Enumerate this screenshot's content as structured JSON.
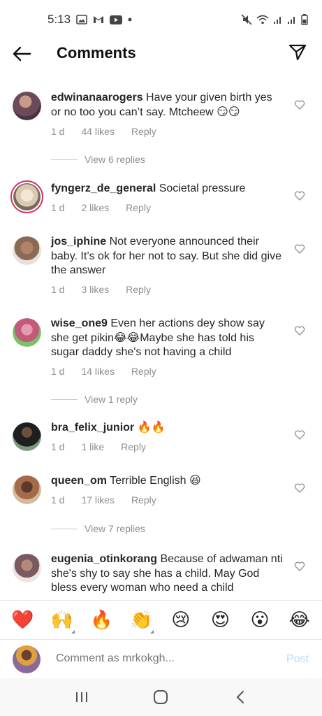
{
  "status_bar": {
    "time": "5:13",
    "icons_left": [
      "gallery-icon",
      "gmail-icon",
      "youtube-icon",
      "dot-icon"
    ],
    "icons_right": [
      "mute-icon",
      "wifi-icon",
      "signal-icon",
      "signal-icon",
      "battery-icon"
    ]
  },
  "header": {
    "title": "Comments",
    "back_icon": "arrow-left-icon",
    "send_icon": "paper-plane-icon"
  },
  "comments": [
    {
      "username": "edwinanaarogers",
      "text": " Have your given birth yes or no too you can’t say. Mtcheew 😏😏",
      "time": "1 d",
      "likes": "44 likes",
      "reply": "Reply",
      "avatar_color": "#6b4a5a",
      "story_ring": false
    },
    {
      "username": "fyngerz_de_general",
      "text": " Societal pressure",
      "time": "1 d",
      "likes": "2 likes",
      "reply": "Reply",
      "avatar_color": "#d9c9b3",
      "story_ring": true
    },
    {
      "username": "jos_iphine",
      "text": " Not everyone announced their baby. It’s ok for her not to say. But she did give the answer",
      "time": "1 d",
      "likes": "3 likes",
      "reply": "Reply",
      "avatar_color": "#8a6a55",
      "story_ring": false
    },
    {
      "username": "wise_one9",
      "text": " Even her actions dey show say she get pikin😂😂Maybe she has told his sugar daddy she's not having a child",
      "time": "1 d",
      "likes": "14 likes",
      "reply": "Reply",
      "avatar_color": "#c25a7a",
      "story_ring": false
    },
    {
      "username": "bra_felix_junior",
      "text": " 🔥🔥",
      "time": "1 d",
      "likes": "1 like",
      "reply": "Reply",
      "avatar_color": "#3a4a3a",
      "story_ring": false
    },
    {
      "username": "queen_om",
      "text": " Terrible English 😆",
      "time": "1 d",
      "likes": "17 likes",
      "reply": "Reply",
      "avatar_color": "#a36b4a",
      "story_ring": false
    },
    {
      "username": "eugenia_otinkorang",
      "text": " Because of adwaman nti she's shy to say she has a child. May God bless every woman who need a child",
      "time": "",
      "likes": "",
      "reply": "",
      "avatar_color": "#7a5a60",
      "story_ring": false
    }
  ],
  "view_replies": [
    "View 6 replies",
    "View 1 reply",
    "View 7 replies"
  ],
  "emoji_bar": [
    "❤️",
    "🙌",
    "🔥",
    "👏",
    "😢",
    "😍",
    "😮",
    "😂"
  ],
  "compose": {
    "placeholder": "Comment as mrkokgh...",
    "post_label": "Post",
    "avatar_color": "#8a6a9a"
  },
  "nav_bar": [
    "recent-apps-icon",
    "home-icon",
    "back-icon"
  ]
}
